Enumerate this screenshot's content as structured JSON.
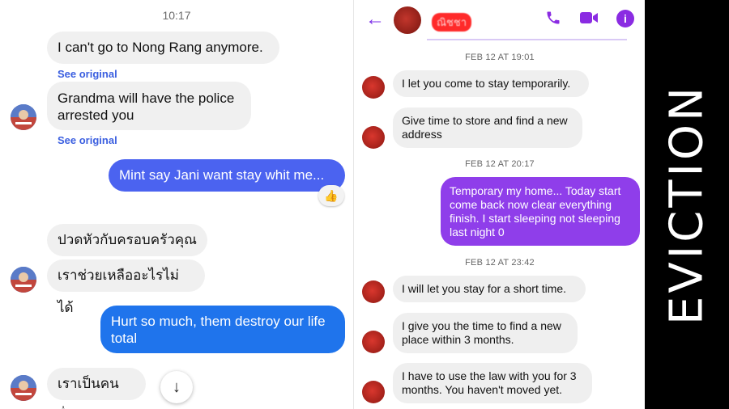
{
  "left_chat": {
    "timestamp": "10:17",
    "see_original": "See original",
    "messages": [
      {
        "text": "I can't go to Nong Rang anymore."
      },
      {
        "text": "Grandma will have the police arrested you"
      },
      {
        "text": "Mint say Jani want stay whit me..."
      },
      {
        "text": "ปวดหัวกับครอบครัวคุณ"
      },
      {
        "text": "เราช่วยเหลืออะไรไม่ได้"
      },
      {
        "text": "Hurt so much, them destroy our life total"
      },
      {
        "text": "เราเป็นคนอื่น"
      }
    ],
    "reaction": "👍",
    "scroll_down_icon": "arrow-down-icon"
  },
  "middle_chat": {
    "contact_name": "ณิชชา",
    "icons": {
      "back": "back-arrow-icon",
      "call": "phone-icon",
      "video": "video-icon",
      "info": "info-icon"
    },
    "date_1": "FEB 12 AT 19:01",
    "date_2": "FEB 12 AT 20:17",
    "date_3": "FEB 12 AT 23:42",
    "messages": [
      {
        "text": "I let you come to stay temporarily."
      },
      {
        "text": "Give time to store and find a new address"
      },
      {
        "text": "Temporary my home... Today start come back now clear everything finish. I start sleeping not sleeping last night 0"
      },
      {
        "text": "I will let you stay for a short time."
      },
      {
        "text": "I give you the time to find a new place within 3 months."
      },
      {
        "text": "I have to use the law with you for 3 months. You haven't moved yet."
      }
    ],
    "colors": {
      "accent": "#8a2be2",
      "outgoing_bubble": "#8f3eea"
    }
  },
  "side_banner": {
    "title": "EVICTION"
  },
  "colors": {
    "left_outgoing_1": "#4b63f0",
    "left_outgoing_2": "#1f74ec"
  }
}
